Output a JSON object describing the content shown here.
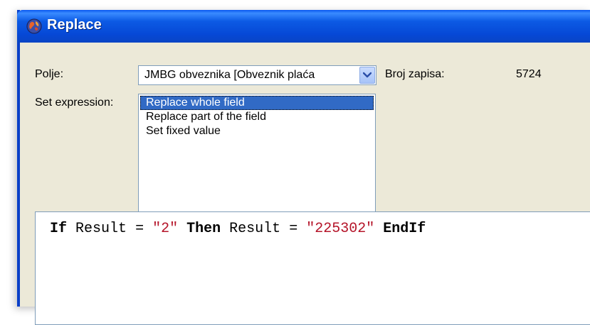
{
  "window": {
    "title": "Replace"
  },
  "form": {
    "field_label": "Polje:",
    "field_value": "JMBG obveznika [Obveznik plaća",
    "record_count_label": "Broj zapisa:",
    "record_count_value": "5724",
    "set_expression_label": "Set expression:",
    "options": [
      "Replace whole field",
      "Replace part of the field",
      "Set fixed value"
    ],
    "selected_option_index": 0
  },
  "editor": {
    "tokens": {
      "kw_if": "If",
      "ident_result_1": "Result",
      "op_eq_1": "=",
      "str_1": "\"2\"",
      "kw_then": "Then",
      "ident_result_2": "Result",
      "op_eq_2": "=",
      "str_2": "\"225302\"",
      "kw_endif": "EndIf"
    }
  },
  "colors": {
    "titlebar": "#0648d6",
    "selection": "#316ac5",
    "string_literal": "#b5152a",
    "dialog_bg": "#ece9d8"
  },
  "icons": {
    "app": "globe-icon",
    "dropdown": "chevron-down-icon"
  }
}
